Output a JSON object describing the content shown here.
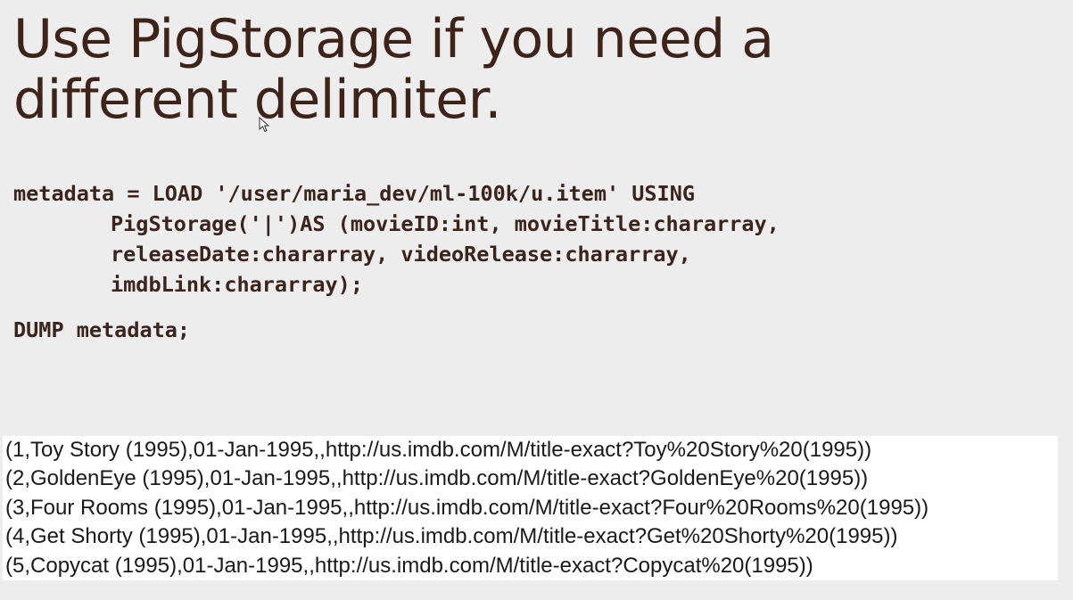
{
  "slide": {
    "title_lines": [
      "Use PigStorage if you need a",
      "different delimiter."
    ],
    "code_lines": [
      "metadata = LOAD '/user/maria_dev/ml-100k/u.item' USING",
      "PigStorage('|')AS (movieID:int, movieTitle:chararray,",
      "releaseDate:chararray, videoRelease:chararray,",
      "imdbLink:chararray);"
    ],
    "dump_line": "DUMP metadata;",
    "output_lines": [
      "(1,Toy Story (1995),01-Jan-1995,,http://us.imdb.com/M/title-exact?Toy%20Story%20(1995))",
      "(2,GoldenEye (1995),01-Jan-1995,,http://us.imdb.com/M/title-exact?GoldenEye%20(1995))",
      "(3,Four Rooms (1995),01-Jan-1995,,http://us.imdb.com/M/title-exact?Four%20Rooms%20(1995))",
      "(4,Get Shorty (1995),01-Jan-1995,,http://us.imdb.com/M/title-exact?Get%20Shorty%20(1995))",
      "(5,Copycat (1995),01-Jan-1995,,http://us.imdb.com/M/title-exact?Copycat%20(1995))"
    ]
  },
  "colors": {
    "background": "#ededed",
    "title": "#3e2418",
    "code": "#3b241b",
    "output_box": "#ffffff",
    "output_text": "#1a1a1a"
  },
  "icons": {
    "cursor": "mouse-pointer-icon"
  }
}
